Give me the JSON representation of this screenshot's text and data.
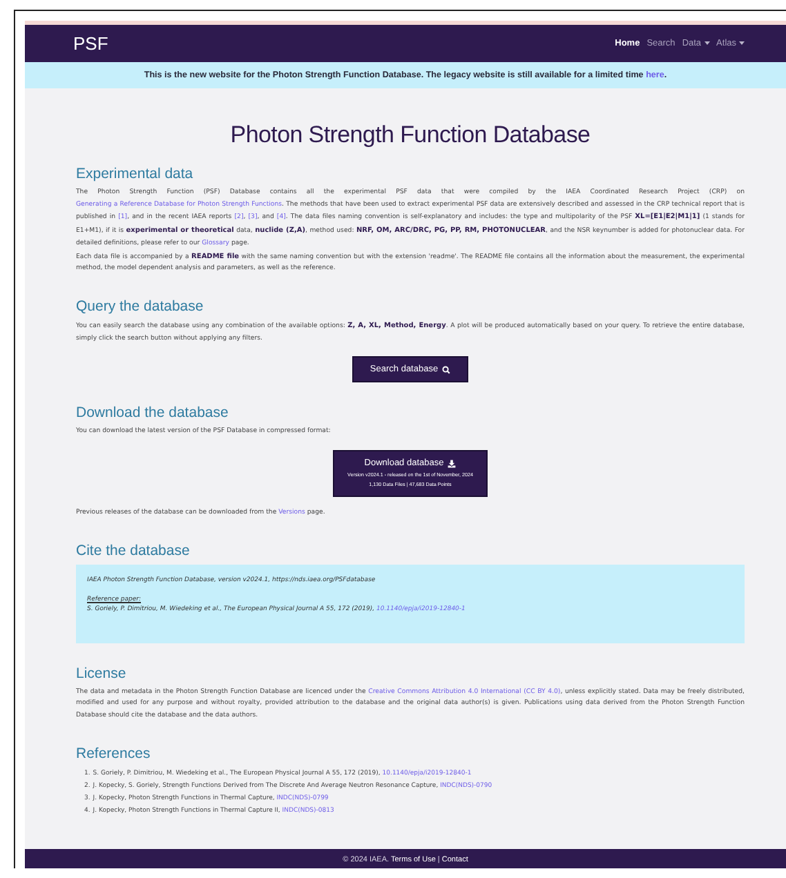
{
  "navbar": {
    "brand": "PSF",
    "items": [
      {
        "label": "Home",
        "selected": true,
        "dropdown": false
      },
      {
        "label": "Search",
        "selected": false,
        "dropdown": false
      },
      {
        "label": "Data",
        "selected": false,
        "dropdown": true
      },
      {
        "label": "Atlas",
        "selected": false,
        "dropdown": true
      }
    ]
  },
  "banner": [
    {
      "kind": "text",
      "text": "This is the new website for the Photon Strength Function Database. The legacy website is still available for a limited time "
    },
    {
      "kind": "link",
      "text": "here"
    },
    {
      "kind": "text",
      "text": "."
    }
  ],
  "title": "Photon Strength Function Database",
  "sections": [
    {
      "kind": "text",
      "heading": "Experimental data",
      "paragraphs": [
        [
          {
            "kind": "text",
            "text": "The Photon Strength Function (PSF) Database contains all the experimental PSF data that were compiled by the IAEA Coordinated Research Project (CRP) on "
          },
          {
            "kind": "link",
            "text": "Generating a Reference Database for Photon Strength Functions"
          },
          {
            "kind": "text",
            "text": ". The methods that have been used to extract experimental PSF data are extensively described and assessed in the CRP technical report that is published in "
          },
          {
            "kind": "link",
            "text": "[1]"
          },
          {
            "kind": "text",
            "text": ", and in the recent IAEA reports "
          },
          {
            "kind": "link",
            "text": "[2]"
          },
          {
            "kind": "text",
            "text": ", "
          },
          {
            "kind": "link",
            "text": "[3]"
          },
          {
            "kind": "text",
            "text": ", and "
          },
          {
            "kind": "link",
            "text": "[4]"
          },
          {
            "kind": "text",
            "text": ". The data files naming convention is self-explanatory and includes: the type and multipolarity of the PSF "
          },
          {
            "kind": "bold",
            "text": "XL=[E1|E2|M1|1]"
          },
          {
            "kind": "text",
            "text": " (1 stands for E1+M1), if it is "
          },
          {
            "kind": "bold",
            "text": "experimental or theoretical"
          },
          {
            "kind": "text",
            "text": " data, "
          },
          {
            "kind": "bold",
            "text": "nuclide (Z,A)"
          },
          {
            "kind": "text",
            "text": ", method used: "
          },
          {
            "kind": "bold",
            "text": "NRF, OM, ARC/DRC, PG, PP, RM, PHOTONUCLEAR"
          },
          {
            "kind": "text",
            "text": ", and the NSR keynumber is added for photonuclear data. For detailed definitions, please refer to our "
          },
          {
            "kind": "link",
            "text": "Glossary"
          },
          {
            "kind": "text",
            "text": " page."
          }
        ],
        [
          {
            "kind": "text",
            "text": "Each data file is accompanied by a "
          },
          {
            "kind": "bold",
            "text": "README file"
          },
          {
            "kind": "text",
            "text": " with the same naming convention but with the extension 'readme'. The README file contains all the information about the measurement, the experimental method, the model dependent analysis and parameters, as well as the reference."
          }
        ]
      ]
    },
    {
      "kind": "search",
      "heading": "Query the database",
      "paragraphs": [
        [
          {
            "kind": "text",
            "text": "You can easily search the database using any combination of the available options: "
          },
          {
            "kind": "bold",
            "text": "Z, A, XL, Method, Energy"
          },
          {
            "kind": "text",
            "text": ". A plot will be produced automatically based on your query. To retrieve the entire database, simply click the search button without applying any filters."
          }
        ]
      ],
      "button": {
        "label": "Search database"
      }
    },
    {
      "kind": "download",
      "heading": "Download the database",
      "paragraphs": [
        [
          {
            "kind": "text",
            "text": "You can download the latest version of the PSF Database in compressed format:"
          }
        ]
      ],
      "button": {
        "label": "Download database",
        "lines": [
          "Version v2024.1 - released on the 1st of November, 2024",
          "1,130 Data Files | 47,683 Data Points"
        ]
      },
      "after": [
        [
          {
            "kind": "text",
            "text": "Previous releases of the database can be downloaded from the "
          },
          {
            "kind": "link",
            "text": "Versions"
          },
          {
            "kind": "text",
            "text": " page."
          }
        ]
      ]
    },
    {
      "kind": "cite",
      "heading": "Cite the database",
      "citation": "IAEA Photon Strength Function Database, version v2024.1, https://nds.iaea.org/PSFdatabase",
      "reference_label": "Reference paper:",
      "reference": [
        {
          "kind": "text",
          "text": "S. Goriely, P. Dimitriou, M. Wiedeking et al., The European Physical Journal A 55, 172 (2019), "
        },
        {
          "kind": "link",
          "text": "10.1140/epja/i2019-12840-1"
        }
      ]
    },
    {
      "kind": "text",
      "heading": "License",
      "paragraphs": [
        [
          {
            "kind": "text",
            "text": "The data and metadata in the Photon Strength Function Database are licenced under the "
          },
          {
            "kind": "link",
            "text": "Creative Commons Attribution 4.0 International (CC BY 4.0)"
          },
          {
            "kind": "text",
            "text": ", unless explicitly stated. Data may be freely distributed, modified and used for any purpose and without royalty, provided attribution to the database and the original data author(s) is given. Publications using data derived from the Photon Strength Function Database should cite the database and the data authors."
          }
        ]
      ]
    },
    {
      "kind": "references",
      "heading": "References",
      "items": [
        {
          "number": "1.",
          "parts": [
            {
              "kind": "text",
              "text": "S. Goriely, P. Dimitriou, M. Wiedeking et al., The European Physical Journal A 55, 172 (2019), "
            },
            {
              "kind": "link",
              "text": "10.1140/epja/i2019-12840-1"
            }
          ]
        },
        {
          "number": "2.",
          "parts": [
            {
              "kind": "text",
              "text": "J. Kopecky, S. Goriely, Strength Functions Derived from The Discrete And Average Neutron Resonance Capture, "
            },
            {
              "kind": "link",
              "text": "INDC(NDS)-0790"
            }
          ]
        },
        {
          "number": "3.",
          "parts": [
            {
              "kind": "text",
              "text": "J. Kopecky, Photon Strength Functions in Thermal Capture, "
            },
            {
              "kind": "link",
              "text": "INDC(NDS)-0799"
            }
          ]
        },
        {
          "number": "4.",
          "parts": [
            {
              "kind": "text",
              "text": "J. Kopecky, Photon Strength Functions in Thermal Capture II, "
            },
            {
              "kind": "link",
              "text": "INDC(NDS)-0813"
            }
          ]
        }
      ]
    }
  ],
  "footer": [
    {
      "kind": "text",
      "text": "© 2024 IAEA. "
    },
    {
      "kind": "link",
      "text": "Terms of Use"
    },
    {
      "kind": "text",
      "text": " | "
    },
    {
      "kind": "link",
      "text": "Contact"
    }
  ]
}
